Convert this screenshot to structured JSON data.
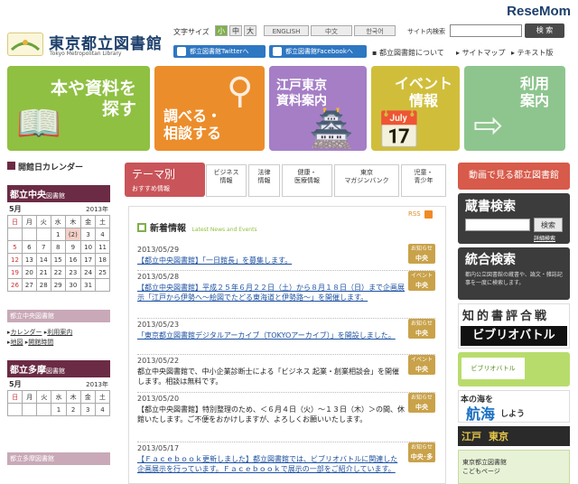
{
  "watermark": "ReseMom",
  "header": {
    "logo_main": "東京都立図書館",
    "logo_sub": "Tokyo Metropolitan Library",
    "font_size_label": "文字サイズ",
    "font_sizes": [
      "小",
      "中",
      "大"
    ],
    "languages": [
      "ENGLISH",
      "中文",
      "한국어"
    ],
    "search_label": "サイト内検索",
    "search_button": "検 索",
    "twitter": "都立図書館Twitterへ",
    "facebook": "都立図書館Facebookへ",
    "links": [
      "都立図書館について",
      "サイトマップ",
      "テキスト版"
    ]
  },
  "tiles": [
    {
      "title": "本や資料を\n探す",
      "color": "#8fc042"
    },
    {
      "title": "調べる・\n相談する",
      "color": "#ec8d2b"
    },
    {
      "title": "江戸東京\n資料案内",
      "color": "#a57ec6"
    },
    {
      "title": "イベント\n情報",
      "color": "#d0be3b"
    },
    {
      "title": "利用\n案内",
      "color": "#8ec58e"
    }
  ],
  "calendar": {
    "title": "開館日カレンダー",
    "central": {
      "name": "都立中央",
      "suffix": "図書館",
      "month": "5月",
      "year": "2013年",
      "weekdays": [
        "日",
        "月",
        "火",
        "水",
        "木",
        "金",
        "土"
      ],
      "rows": [
        [
          "",
          "",
          "",
          "1",
          "(2)",
          "3",
          "4"
        ],
        [
          "5",
          "6",
          "7",
          "8",
          "9",
          "10",
          "11"
        ],
        [
          "12",
          "13",
          "14",
          "15",
          "16",
          "17",
          "18"
        ],
        [
          "19",
          "20",
          "21",
          "22",
          "23",
          "24",
          "25"
        ],
        [
          "26",
          "27",
          "28",
          "29",
          "30",
          "31",
          ""
        ]
      ]
    },
    "central_menu_title": "都立中央図書館",
    "central_menu": [
      "カレンダー",
      "利用案内",
      "地図",
      "開館時間"
    ],
    "tama": {
      "name": "都立多摩",
      "suffix": "図書館",
      "month": "5月",
      "year": "2013年",
      "weekdays": [
        "日",
        "月",
        "火",
        "水",
        "木",
        "金",
        "土"
      ],
      "rows": [
        [
          "",
          "",
          "",
          "1",
          "2",
          "3",
          "4"
        ]
      ]
    },
    "tama_menu_title": "都立多摩図書館"
  },
  "themes": {
    "tab_title": "テーマ別",
    "tab_sub": "おすすめ情報",
    "categories": [
      "ビジネス\n情報",
      "法律\n情報",
      "健康・\n医療情報",
      "東京\nマガジンバンク",
      "児童・\n青少年"
    ]
  },
  "news": {
    "title": "新着情報",
    "title_en": "Latest News and Events",
    "rss": "RSS",
    "items": [
      {
        "date": "2013/05/29",
        "link": "【都立中央図書館】「一日館長」を募集します。",
        "text": "",
        "badge_top": "お知らせ",
        "badge": "中央",
        "badge_color": "#c9a24a"
      },
      {
        "date": "2013/05/28",
        "link": "【都立中央図書館】平成２５年６月２２日（土）から８月１８日（日）まで企画展示「江戸から伊勢へ～絵図でたどる東海道と伊勢路～」を開催します。",
        "text": "",
        "badge_top": "イベント",
        "badge": "中央",
        "badge_color": "#c9a24a"
      },
      {
        "date": "2013/05/23",
        "link": "「東京都立図書館デジタルアーカイブ（TOKYOアーカイブ）」を開設しました。",
        "text": "",
        "badge_top": "お知らせ",
        "badge": "中央",
        "badge_color": "#c9a24a"
      },
      {
        "date": "2013/05/22",
        "link": "",
        "text": "都立中央図書館で、中小企業診断士による「ビジネス 起業・創業相談会」を開催します。相談は無料です。",
        "badge_top": "イベント",
        "badge": "中央",
        "badge_color": "#c9a24a"
      },
      {
        "date": "2013/05/20",
        "link": "",
        "text": "【都立中央図書館】特別整理のため、＜６月４日（火）～１３日（木）＞の間、休館いたします。ご不便をおかけしますが、よろしくお願いいたします。",
        "badge_top": "お知らせ",
        "badge": "中央",
        "badge_color": "#c9a24a"
      },
      {
        "date": "2013/05/17",
        "link": "【Ｆａｃｅｂｏｏｋ更新しました】都立図書館では、ビブリオバトルに関連した企画展示を行っています。Ｆａｃｅｂｏｏｋで展示の一部をご紹介しています。",
        "text": "",
        "badge_top": "お知らせ",
        "badge": "中央･多摩",
        "badge_color": "#c9a24a"
      }
    ]
  },
  "right": {
    "video": "動画で見る都立図書館",
    "catalog_title": "蔵書検索",
    "catalog_button": "検索",
    "catalog_detail": "詳細検索",
    "union_title": "統合検索",
    "union_desc": "都内公立図書館の蔵書や、論文・雑誌記事を一度に検索します。",
    "biblio_top": "知的書評合戦",
    "biblio_main": "ビブリオバトル",
    "biblio_banner": "ビブリオバトル",
    "ocean": "本の海を",
    "ocean_big": "航海",
    "ocean_tail": "しよう",
    "edo1": "江戸",
    "edo2": "東京",
    "kids": "東京都立図書館\nこどもページ"
  }
}
